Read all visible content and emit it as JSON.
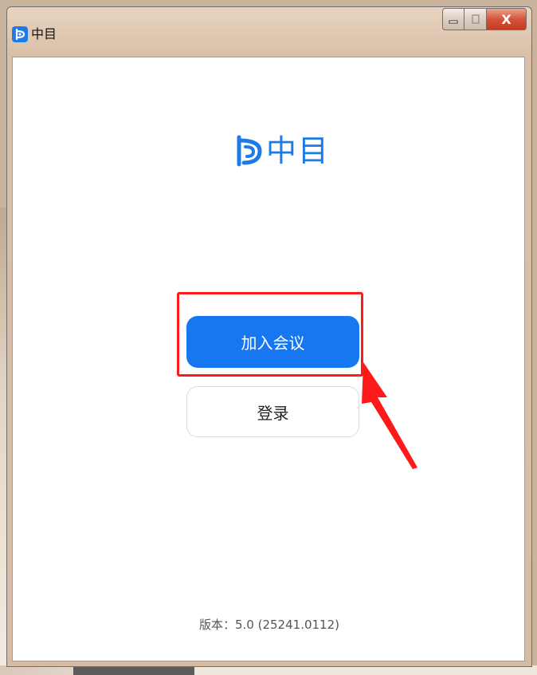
{
  "window": {
    "title": "中目",
    "close_label": "X"
  },
  "brand": {
    "name": "中目"
  },
  "actions": {
    "join_label": "加入会议",
    "login_label": "登录"
  },
  "footer": {
    "version": "版本：5.0 (25241.0112)"
  },
  "colors": {
    "accent": "#1677f0",
    "annotation": "#ff1a1a"
  }
}
